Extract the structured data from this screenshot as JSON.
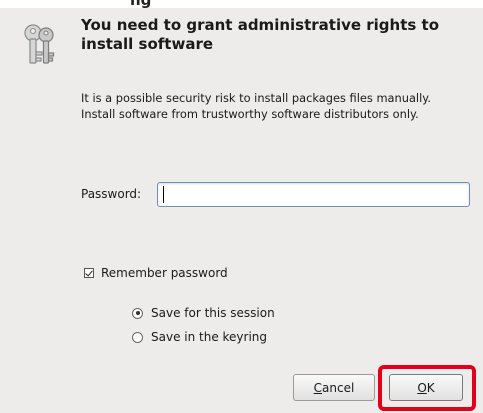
{
  "window": {
    "title_fragment": "ng"
  },
  "dialog": {
    "icon": "keys-icon",
    "heading": "You need to grant administrative rights to install software",
    "description": "It is a possible security risk to install packages files manually.\nInstall software from trustworthy software distributors only.",
    "password": {
      "label": "Password:",
      "value": ""
    },
    "remember": {
      "label": "Remember password",
      "checked": true
    },
    "save_options": [
      {
        "label": "Save for this session",
        "selected": true
      },
      {
        "label": "Save in the keyring",
        "selected": false
      }
    ],
    "buttons": {
      "cancel_mnemonic": "C",
      "cancel_rest": "ancel",
      "ok_mnemonic": "O",
      "ok_rest": "K"
    },
    "highlight_color": "#e3001b"
  }
}
